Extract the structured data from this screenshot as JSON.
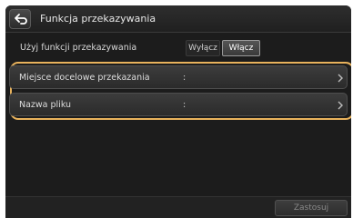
{
  "header": {
    "title": "Funkcja przekazywania",
    "back_icon": "back-arrow-icon"
  },
  "use_function": {
    "label": "Użyj funkcji przekazywania",
    "off_label": "Wyłącz",
    "on_label": "Włącz",
    "selected": "Włącz"
  },
  "settings": {
    "items": [
      {
        "label": "Miejsce docelowe przekazania",
        "value": ":"
      },
      {
        "label": "Nazwa pliku",
        "value": ":"
      }
    ]
  },
  "footer": {
    "apply_label": "Zastosuj"
  },
  "colors": {
    "highlight": "#e8b25c",
    "background": "#1c1c1c"
  }
}
